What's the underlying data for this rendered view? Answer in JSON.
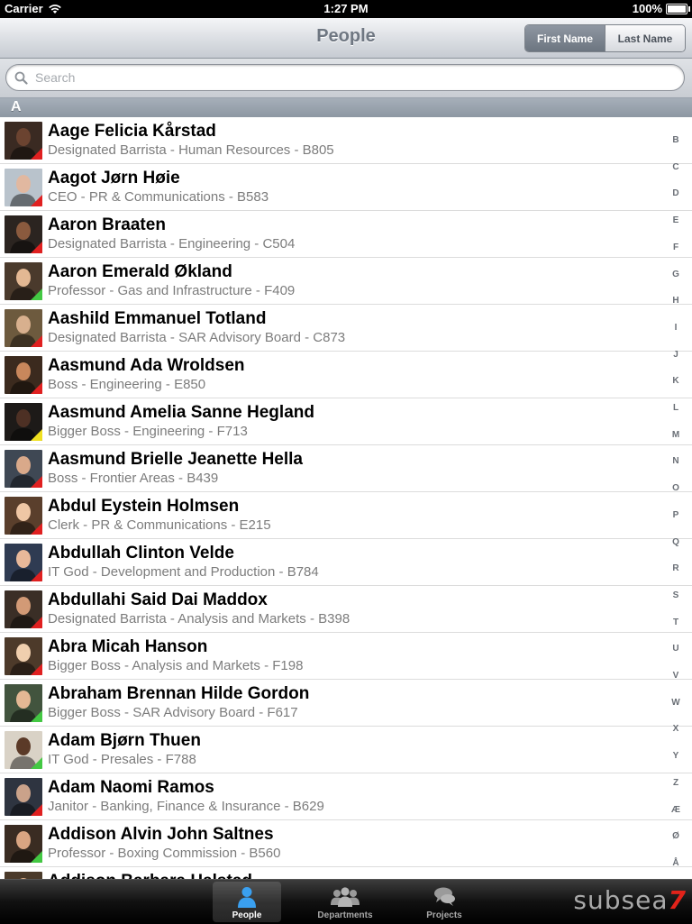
{
  "status_bar": {
    "carrier": "Carrier",
    "time": "1:27 PM",
    "battery": "100%"
  },
  "navbar": {
    "title": "People",
    "sort_options": [
      "First Name",
      "Last Name"
    ],
    "selected_sort": "First Name"
  },
  "search": {
    "placeholder": "Search",
    "value": ""
  },
  "section": {
    "letter": "A"
  },
  "people": [
    {
      "name": "Aage Felicia Kårstad",
      "detail": "Designated Barrista - Human Resources - B805",
      "status_color": "#e02020",
      "avatar_bg": "#3a2a22",
      "avatar_face": "#6b4330"
    },
    {
      "name": "Aagot Jørn Høie",
      "detail": "CEO - PR & Communications - B583",
      "status_color": "#e02020",
      "avatar_bg": "#b9c3cc",
      "avatar_face": "#e1b8a0"
    },
    {
      "name": "Aaron Braaten",
      "detail": "Designated Barrista - Engineering - C504",
      "status_color": "#e02020",
      "avatar_bg": "#2b2420",
      "avatar_face": "#8a5a3e"
    },
    {
      "name": "Aaron Emerald Økland",
      "detail": "Professor - Gas and Infrastructure - F409",
      "status_color": "#43c843",
      "avatar_bg": "#4a3a2c",
      "avatar_face": "#e3b893"
    },
    {
      "name": "Aashild Emmanuel Totland",
      "detail": "Designated Barrista - SAR Advisory Board - C873",
      "status_color": "#e02020",
      "avatar_bg": "#6d5a3e",
      "avatar_face": "#d8b08e"
    },
    {
      "name": "Aasmund Ada Wroldsen",
      "detail": "Boss - Engineering - E850",
      "status_color": "#e02020",
      "avatar_bg": "#3b2a1e",
      "avatar_face": "#c8875c"
    },
    {
      "name": "Aasmund Amelia Sanne Hegland",
      "detail": "Bigger Boss - Engineering - F713",
      "status_color": "#f0e020",
      "avatar_bg": "#1d1a18",
      "avatar_face": "#4d3024"
    },
    {
      "name": "Aasmund Brielle Jeanette Hella",
      "detail": "Boss - Frontier Areas - B439",
      "status_color": "#e02020",
      "avatar_bg": "#3f4854",
      "avatar_face": "#d9a98a"
    },
    {
      "name": "Abdul Eystein Holmsen",
      "detail": "Clerk - PR & Communications - E215",
      "status_color": "#e02020",
      "avatar_bg": "#5a3f2c",
      "avatar_face": "#efc7a5"
    },
    {
      "name": "Abdullah Clinton Velde",
      "detail": "IT God - Development and Production - B784",
      "status_color": "#e02020",
      "avatar_bg": "#2f3b52",
      "avatar_face": "#e8b89a"
    },
    {
      "name": "Abdullahi Said Dai Maddox",
      "detail": "Designated Barrista - Analysis and Markets - B398",
      "status_color": "#e02020",
      "avatar_bg": "#3a2e26",
      "avatar_face": "#d29a76"
    },
    {
      "name": "Abra Micah Hanson",
      "detail": "Bigger Boss - Analysis and Markets - F198",
      "status_color": "#e02020",
      "avatar_bg": "#4d3a2a",
      "avatar_face": "#f0cfae"
    },
    {
      "name": "Abraham Brennan Hilde Gordon",
      "detail": "Bigger Boss - SAR Advisory Board - F617",
      "status_color": "#43c843",
      "avatar_bg": "#42543e",
      "avatar_face": "#e4b894"
    },
    {
      "name": "Adam Bjørn Thuen",
      "detail": "IT God - Presales - F788",
      "status_color": "#43c843",
      "avatar_bg": "#d9d2c6",
      "avatar_face": "#5b3a28"
    },
    {
      "name": "Adam Naomi Ramos",
      "detail": "Janitor - Banking, Finance & Insurance - B629",
      "status_color": "#e02020",
      "avatar_bg": "#2e3440",
      "avatar_face": "#caa28a"
    },
    {
      "name": "Addison Alvin John Saltnes",
      "detail": "Professor - Boxing Commission - B560",
      "status_color": "#43c843",
      "avatar_bg": "#3a2c22",
      "avatar_face": "#d9a582"
    },
    {
      "name": "Addison Barbara Halstad",
      "detail": "",
      "status_color": "#e02020",
      "avatar_bg": "#4a3a2a",
      "avatar_face": "#e2b58f"
    }
  ],
  "index_letters": [
    "B",
    "C",
    "D",
    "E",
    "F",
    "G",
    "H",
    "I",
    "J",
    "K",
    "L",
    "M",
    "N",
    "O",
    "P",
    "Q",
    "R",
    "S",
    "T",
    "U",
    "V",
    "W",
    "X",
    "Y",
    "Z",
    "Æ",
    "Ø",
    "Å"
  ],
  "tabs": [
    {
      "label": "People",
      "icon": "person-icon",
      "selected": true
    },
    {
      "label": "Departments",
      "icon": "group-icon",
      "selected": false
    },
    {
      "label": "Projects",
      "icon": "speech-bubbles-icon",
      "selected": false
    }
  ],
  "logo": {
    "text": "subsea",
    "number": "7"
  },
  "colors": {
    "status_red": "#e02020",
    "status_green": "#43c843",
    "status_yellow": "#f0e020",
    "accent_tab": "#3aa0f0"
  }
}
